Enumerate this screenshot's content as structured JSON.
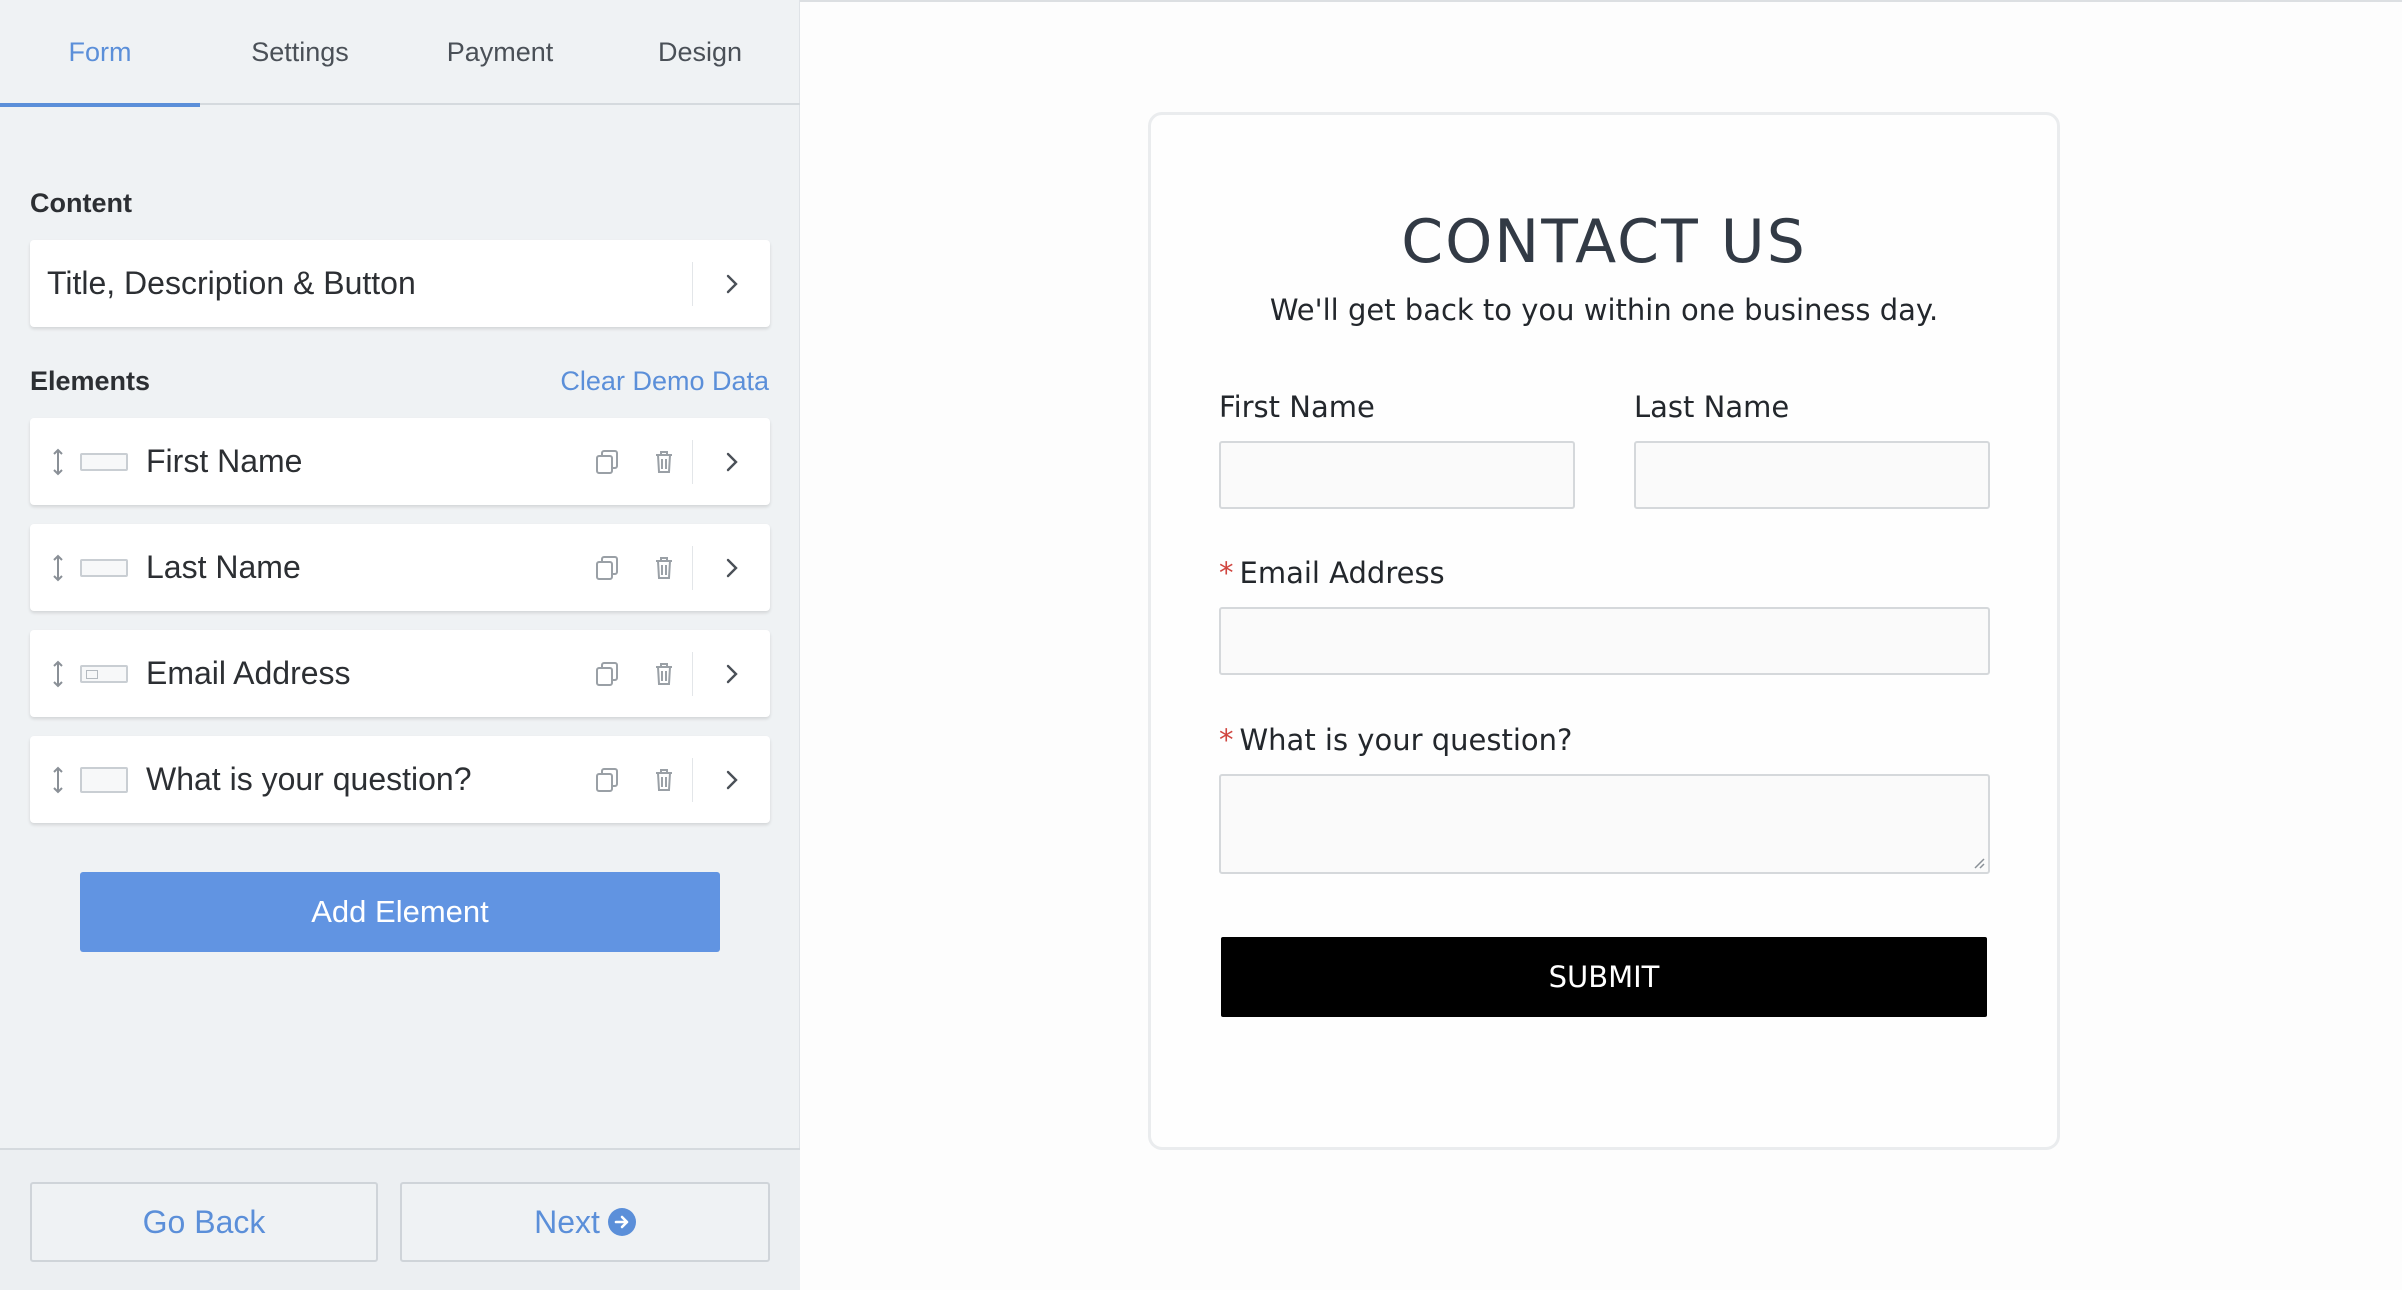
{
  "tabs": [
    "Form",
    "Settings",
    "Payment",
    "Design"
  ],
  "active_tab": "Form",
  "content": {
    "label": "Content",
    "card_title": "Title, Description & Button"
  },
  "elements": {
    "label": "Elements",
    "clear_link": "Clear Demo Data",
    "items": [
      {
        "label": "First Name",
        "type": "text"
      },
      {
        "label": "Last Name",
        "type": "text"
      },
      {
        "label": "Email Address",
        "type": "email"
      },
      {
        "label": "What is your question?",
        "type": "textarea"
      }
    ]
  },
  "add_element_label": "Add Element",
  "footer": {
    "back_label": "Go Back",
    "next_label": "Next"
  },
  "form": {
    "title": "CONTACT US",
    "subtitle": "We'll get back to you within one business day.",
    "first_name_label": "First Name",
    "last_name_label": "Last Name",
    "email_label": "Email Address",
    "question_label": "What is your question?",
    "required_marker": "*",
    "first_name_value": "",
    "last_name_value": "",
    "email_value": "",
    "question_value": "",
    "submit_label": "SUBMIT"
  },
  "icons": {
    "drag": "drag-handle-icon",
    "duplicate": "duplicate-icon",
    "delete": "trash-icon",
    "chevron": "chevron-right-icon",
    "next": "arrow-circle-right-icon"
  },
  "colors": {
    "accent": "#5b8fd9",
    "add_button": "#6194e2",
    "required": "#d0453f",
    "submit": "#000000",
    "sidebar_bg": "#eff2f4"
  }
}
